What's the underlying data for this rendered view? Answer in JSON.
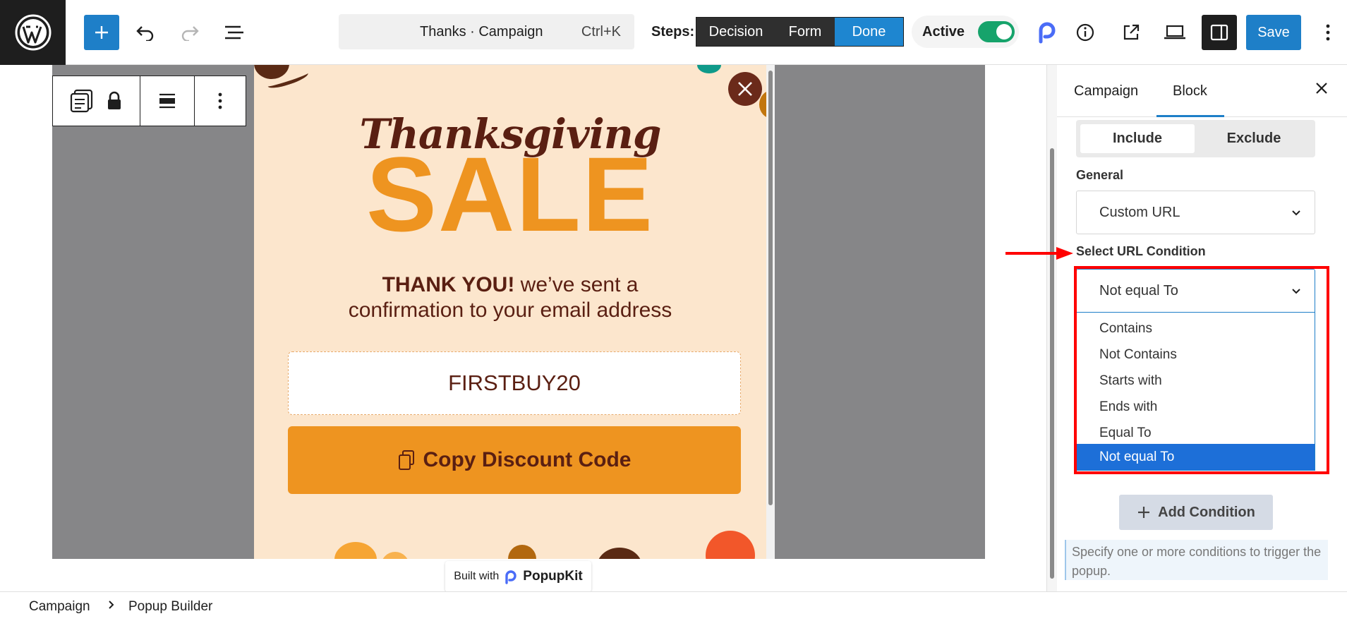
{
  "topbar": {
    "command_title": "Thanks · Campaign",
    "command_shortcut": "Ctrl+K",
    "steps_label": "Steps:",
    "steps": [
      "Decision",
      "Form",
      "Done"
    ],
    "active_label": "Active",
    "save_label": "Save"
  },
  "popup": {
    "heading_script": "Thanksgiving",
    "heading_big": "SALE",
    "message_bold": "THANK YOU!",
    "message_rest_line1": " we’ve sent a",
    "message_line2": "confirmation to your email address",
    "code": "FIRSTBUY20",
    "copy_button": "Copy Discount Code",
    "built_with": "Built with",
    "brand": "PopupKit"
  },
  "sidebar": {
    "tabs": [
      "Campaign",
      "Block"
    ],
    "active_tab": "Block",
    "include_label": "Include",
    "exclude_label": "Exclude",
    "general_label": "General",
    "general_value": "Custom URL",
    "url_condition_label": "Select URL Condition",
    "url_condition_value": "Not equal To",
    "url_condition_options": [
      "Contains",
      "Not Contains",
      "Starts with",
      "Ends with",
      "Equal To",
      "Not equal To"
    ],
    "add_condition": "Add Condition",
    "help_text": "Specify one or more conditions to trigger the popup."
  },
  "breadcrumb": {
    "items": [
      "Campaign",
      "Popup Builder"
    ]
  },
  "colors": {
    "accent": "#1e7fc8",
    "popup_bg": "#fce6cd",
    "sale_orange": "#ee9420",
    "brown": "#5a1f12",
    "highlight_red": "#ff0000",
    "toggle_green": "#16a36b"
  }
}
